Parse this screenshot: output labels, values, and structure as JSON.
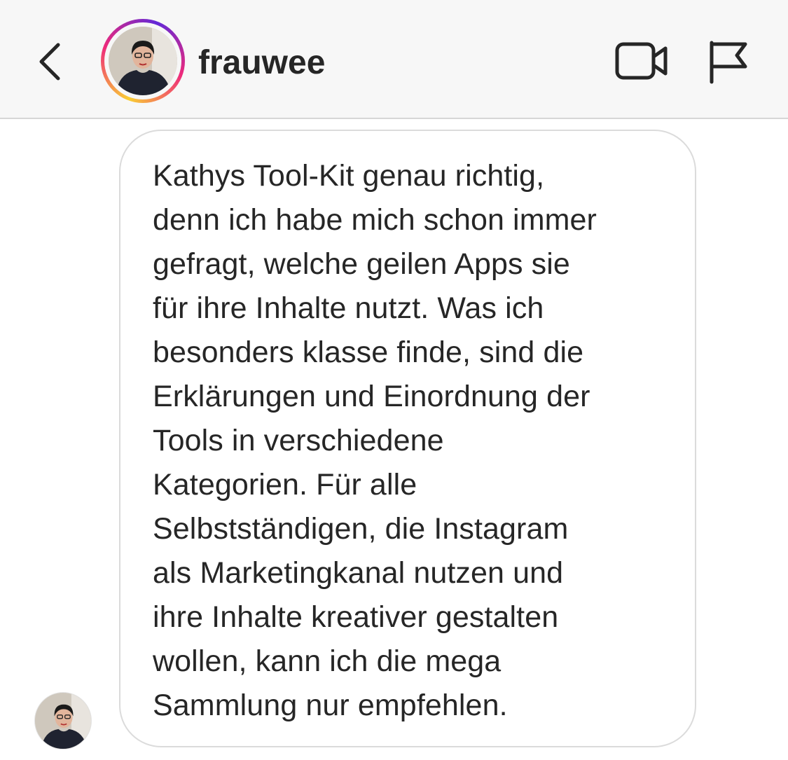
{
  "header": {
    "username": "frauwee",
    "back_icon": "chevron-left-icon",
    "video_icon": "video-camera-icon",
    "flag_icon": "flag-icon"
  },
  "message": {
    "text": "Kathys Tool-Kit genau richtig,\ndenn ich habe mich schon immer\ngefragt, welche geilen Apps sie\nfür ihre Inhalte nutzt. Was ich\nbesonders klasse finde, sind die\nErklärungen und Einordnung der\nTools in verschiedene\nKategorien. Für alle\nSelbstständigen, die Instagram\nals Marketingkanal nutzen und\nihre Inhalte kreativer gestalten\nwollen, kann ich die mega\nSammlung nur empfehlen."
  },
  "colors": {
    "header_bg": "#f7f7f7",
    "text": "#262626",
    "bubble_border": "#dbdbdb",
    "story_ring": "#ee2a7b"
  }
}
